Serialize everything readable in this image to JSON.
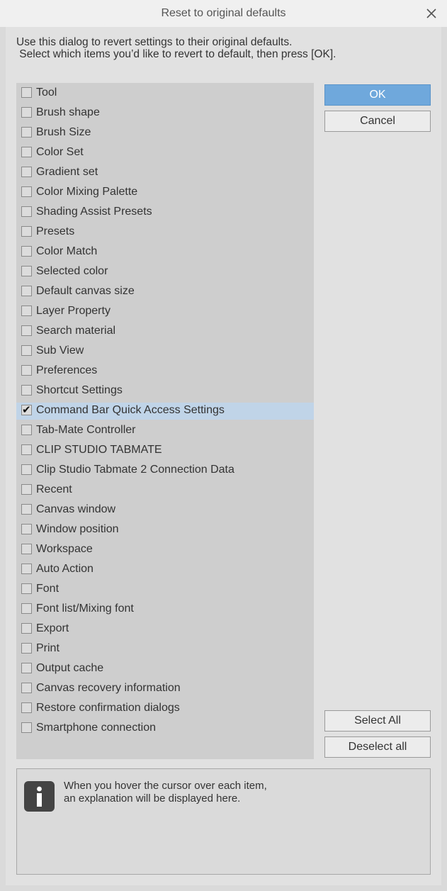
{
  "dialog": {
    "title": "Reset to original defaults",
    "intro_line1": "Use this dialog to revert settings to their original defaults.",
    "intro_line2": " Select which items you’d like to revert to default, then press [OK]."
  },
  "items": [
    {
      "label": "Tool",
      "checked": false
    },
    {
      "label": "Brush shape",
      "checked": false
    },
    {
      "label": "Brush Size",
      "checked": false
    },
    {
      "label": "Color Set",
      "checked": false
    },
    {
      "label": "Gradient set",
      "checked": false
    },
    {
      "label": "Color Mixing Palette",
      "checked": false
    },
    {
      "label": "Shading Assist Presets",
      "checked": false
    },
    {
      "label": "Presets",
      "checked": false
    },
    {
      "label": "Color Match",
      "checked": false
    },
    {
      "label": "Selected color",
      "checked": false
    },
    {
      "label": "Default canvas size",
      "checked": false
    },
    {
      "label": "Layer Property",
      "checked": false
    },
    {
      "label": "Search material",
      "checked": false
    },
    {
      "label": "Sub View",
      "checked": false
    },
    {
      "label": "Preferences",
      "checked": false
    },
    {
      "label": "Shortcut Settings",
      "checked": false
    },
    {
      "label": "Command Bar Quick Access Settings",
      "checked": true,
      "selected": true
    },
    {
      "label": "Tab-Mate Controller",
      "checked": false
    },
    {
      "label": "CLIP STUDIO TABMATE",
      "checked": false
    },
    {
      "label": "Clip Studio Tabmate 2 Connection Data",
      "checked": false
    },
    {
      "label": "Recent",
      "checked": false
    },
    {
      "label": "Canvas window",
      "checked": false
    },
    {
      "label": "Window position",
      "checked": false
    },
    {
      "label": "Workspace",
      "checked": false
    },
    {
      "label": "Auto Action",
      "checked": false
    },
    {
      "label": "Font",
      "checked": false
    },
    {
      "label": "Font list/Mixing font",
      "checked": false
    },
    {
      "label": "Export",
      "checked": false
    },
    {
      "label": "Print",
      "checked": false
    },
    {
      "label": "Output cache",
      "checked": false
    },
    {
      "label": "Canvas recovery information",
      "checked": false
    },
    {
      "label": "Restore confirmation dialogs",
      "checked": false
    },
    {
      "label": "Smartphone connection",
      "checked": false
    }
  ],
  "buttons": {
    "ok": "OK",
    "cancel": "Cancel",
    "select_all": "Select All",
    "deselect_all": "Deselect all"
  },
  "info": {
    "icon": "info-icon",
    "line1": "When you hover the cursor over each item,",
    "line2": "an explanation will be displayed here."
  },
  "colors": {
    "primary_button": "#6fa8dc",
    "selected_row": "#c0d4e8"
  }
}
